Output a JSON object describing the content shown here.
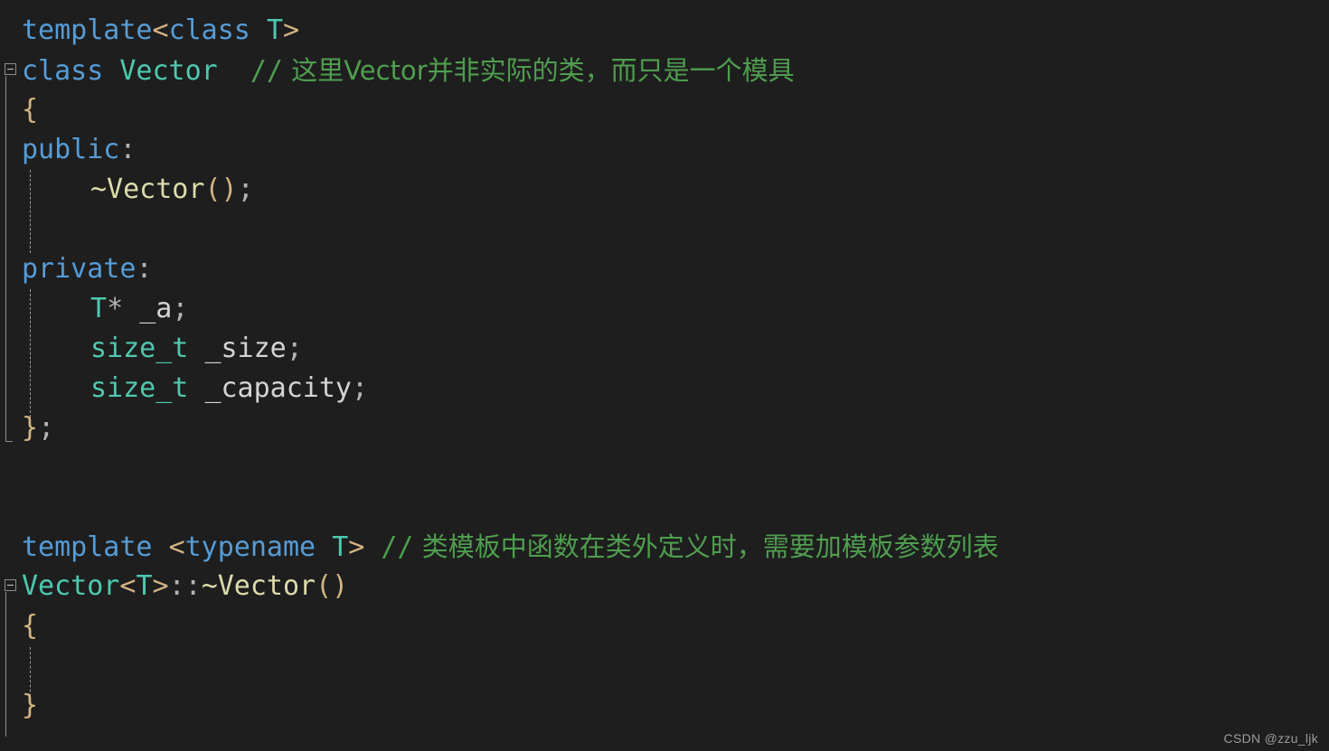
{
  "editor": {
    "background_color": "#1e1e1e",
    "watermark": "CSDN @zzu_ljk"
  },
  "colors": {
    "background": "#1e1e1e",
    "keyword": "#569cd6",
    "type": "#4ec9b0",
    "function": "#dcdcaa",
    "variable": "#d4d4d4",
    "punctuation": "#d4b483",
    "operator": "#b4b4b4",
    "comment": "#4f9e4f",
    "guide": "#8c8c8c"
  },
  "code": {
    "line1": {
      "kw_template": "template",
      "lt": "<",
      "kw_class": "class",
      "sp": " ",
      "type_T": "T",
      "gt": ">"
    },
    "line2": {
      "kw_class": "class",
      "type_vector": "Vector",
      "comment_slashes": "//",
      "comment_text": "这里Vector并非实际的类，而只是一个模具"
    },
    "line3": {
      "brace_open": "{"
    },
    "line4": {
      "kw_public": "public",
      "colon": ":"
    },
    "line5": {
      "fn_dtor": "~Vector",
      "parens": "()",
      "semi": ";"
    },
    "line7": {
      "kw_private": "private",
      "colon": ":"
    },
    "line8": {
      "type_T": "T",
      "star": "*",
      "var_a": "_a",
      "semi": ";"
    },
    "line9": {
      "type_size_t": "size_t",
      "var_size": "_size",
      "semi": ";"
    },
    "line10": {
      "type_size_t": "size_t",
      "var_capacity": "_capacity",
      "semi": ";"
    },
    "line11": {
      "brace_close": "}",
      "semi": ";"
    },
    "line14": {
      "kw_template": "template",
      "lt": "<",
      "kw_typename": "typename",
      "type_T": "T",
      "gt": ">",
      "comment_slashes": "//",
      "comment_text": "类模板中函数在类外定义时，需要加模板参数列表"
    },
    "line15": {
      "type_vector": "Vector",
      "lt": "<",
      "type_T": "T",
      "gt": ">",
      "scope": "::",
      "fn_dtor": "~Vector",
      "parens": "()"
    },
    "line16": {
      "brace_open": "{"
    },
    "line18": {
      "brace_close": "}"
    }
  }
}
